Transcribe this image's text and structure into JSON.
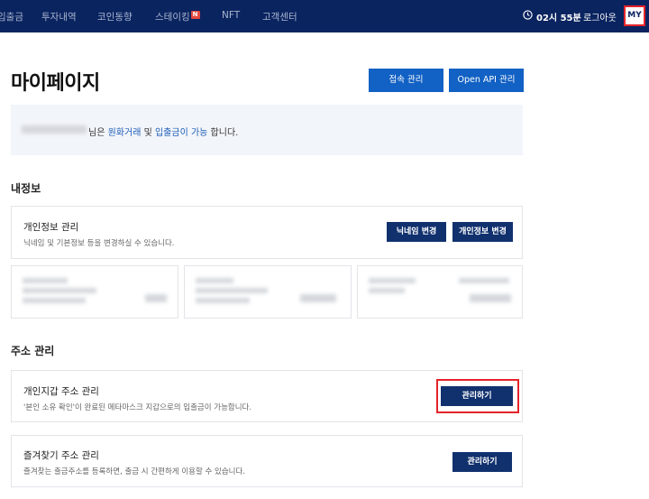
{
  "nav": {
    "items": [
      "입출금",
      "투자내역",
      "코인동향",
      "스테이킹",
      "NFT",
      "고객센터"
    ],
    "staking_badge": "N",
    "time": "02시 55분",
    "logout": "로그아웃",
    "my": "MY"
  },
  "page": {
    "title": "마이페이지",
    "access_btn": "접속 관리",
    "api_btn": "Open API 관리"
  },
  "notice": {
    "prefix": "님은 ",
    "link1": "원화거래",
    "middle": " 및 ",
    "link2": "입출금이 가능",
    "suffix": " 합니다."
  },
  "myinfo": {
    "section_title": "내정보",
    "card_title": "개인정보 관리",
    "card_desc": "닉네임 및 기본정보 등을 변경하실 수 있습니다.",
    "nickname_btn": "닉네임 변경",
    "info_btn": "개인정보 변경"
  },
  "address": {
    "section_title": "주소 관리",
    "wallet_title": "개인지갑 주소 관리",
    "wallet_desc": "'본인 소유 확인'이 완료된 메타마스크 지갑으로의 입출금이 가능합니다.",
    "wallet_btn": "관리하기",
    "fav_title": "즐겨찾기 주소 관리",
    "fav_desc": "즐겨찾는 출금주소를 등록하면, 출금 시 간편하게 이용할 수 있습니다.",
    "fav_btn": "관리하기"
  }
}
